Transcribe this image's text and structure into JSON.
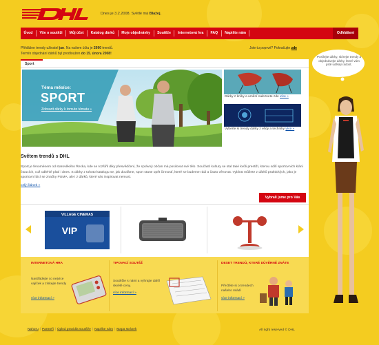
{
  "header": {
    "logo_text": "DHL",
    "greeting_prefix": "Dnes je 3.2.2008. Světlé má ",
    "greeting_name": "Blažej."
  },
  "nav": {
    "items": [
      "Úvod",
      "Vše o soutěži",
      "Můj účet",
      "Katalog dárků",
      "Moje objednávky",
      "Soutěže",
      "Internetová hra",
      "FAQ",
      "Napište nám"
    ],
    "logout": "Odhlášení"
  },
  "intro": {
    "line1_a": "Přihlášen trendy uživatel ",
    "line1_user": "jan",
    "line1_b": ". Na vašem účtu je ",
    "line1_points": "2990",
    "line1_c": " trendů.",
    "line2_a": "Termín objednání dárků byl prodloužen ",
    "line2_date": "do 15. února 2008!"
  },
  "register": {
    "text": "Jste tu poprvé? Pokračujte ",
    "link": "zde"
  },
  "tab": {
    "label": "Sport"
  },
  "hero": {
    "subtitle": "Téma měsíce:",
    "title": "SPORT",
    "link": "Zobrazit dárky k tomuto tématu »"
  },
  "side": {
    "caption1": "Dárky z kníky a umění naleznete zde",
    "caption1_link": "více »",
    "caption2": "Vyberte si trendy dárky z vědy a techniky",
    "caption2_link": "více »"
  },
  "section": {
    "title": "Světem trendů s DHL",
    "text": "Sport je fenoménem od starověkého Řecka, kde se rozšířil díky přesvědčení, že správný občan má posilovat své tělo. Součástí kultury se stal také kvůli prestiži, kterou sdílí sportovních klání čtoucích, což odlehlé platí i dnes. S dárky z tohoto katalogu se, jak doufáme, sport stane opět činností, které se budeme rádi a často věnovat. Vybírat můžete z dárků praktických, jako je sportovní bicí se značky PUMA, ale i z dárků, které vás inspirovat nemusí.",
    "more": "celý článek »"
  },
  "carousel": {
    "button": "Vybrali jsme pro Vás",
    "cinema_brand": "VILLAGE CINEMAS",
    "vip_label": "VIP"
  },
  "promos": [
    {
      "title": "INTERNETOVÁ HRA",
      "text": "Nastřádejte co nejvíce vajíček a získejte trendy",
      "link": "více informací »"
    },
    {
      "title": "TIPOVACÍ SOUTĚŽ",
      "text": "Soutěžte s námi a vyhrajte další skvělé ceny.",
      "link": "více informací »"
    },
    {
      "title": "DESET TRENDŮ, KTERÉ DŮVĚRNĚ ZNÁTE",
      "text": "Přečtěte si o trendech našeho mládí",
      "link": "více informací »"
    }
  ],
  "footer": {
    "links": [
      "Nahoru",
      "Partneři",
      "Úplná pravidla soutěže",
      "Napište nám",
      "Mapa stránek"
    ],
    "copyright": "All right reserved © DHL"
  },
  "speech": {
    "text": "Posílejte dárky, sbírejte trendy a objednávejte dárky, které vám jistě udělají radost."
  },
  "colors": {
    "brand_red": "#d40511",
    "brand_yellow": "#f4cc20"
  }
}
